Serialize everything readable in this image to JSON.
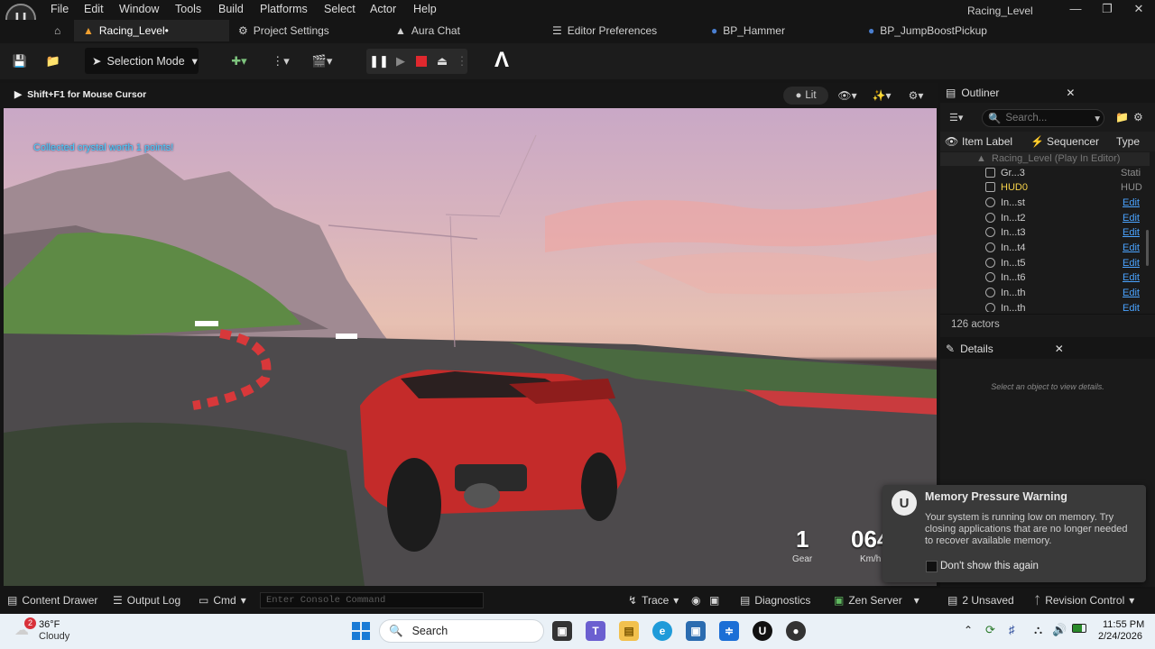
{
  "menu": [
    "File",
    "Edit",
    "Window",
    "Tools",
    "Build",
    "Platforms",
    "Select",
    "Actor",
    "Help"
  ],
  "window_title": "Racing_Level",
  "tabs": {
    "level": "Racing_Level•",
    "project_settings": "Project Settings",
    "aura_chat": "Aura Chat",
    "editor_preferences": "Editor Preferences",
    "bp_hammer": "BP_Hammer",
    "bp_jump": "BP_JumpBoostPickup"
  },
  "toolbar": {
    "selection_mode": "Selection Mode"
  },
  "viewport": {
    "hint": "Shift+F1 for Mouse Cursor",
    "lit": "Lit",
    "message": "Collected crystal worth 1 points!",
    "gear_value": "1",
    "gear_label": "Gear",
    "speed_value": "064",
    "speed_label": "Km/h"
  },
  "outliner": {
    "title": "Outliner",
    "search_placeholder": "Search...",
    "col_label": "Item Label",
    "col_sequencer": "Sequencer",
    "col_type": "Type",
    "root": "Racing_Level (Play In Editor)",
    "rows": [
      {
        "name": "Gr...3",
        "type": "Stati"
      },
      {
        "name": "HUD0",
        "type": "HUD"
      },
      {
        "name": "In...st",
        "type": "Edit"
      },
      {
        "name": "In...t2",
        "type": "Edit"
      },
      {
        "name": "In...t3",
        "type": "Edit"
      },
      {
        "name": "In...t4",
        "type": "Edit"
      },
      {
        "name": "In...t5",
        "type": "Edit"
      },
      {
        "name": "In...t6",
        "type": "Edit"
      },
      {
        "name": "In...th",
        "type": "Edit"
      },
      {
        "name": "In...th",
        "type": "Edit"
      }
    ],
    "count": "126 actors"
  },
  "details": {
    "title": "Details",
    "empty": "Select an object to view details."
  },
  "toast": {
    "title": "Memory Pressure Warning",
    "body": "Your system is running low on memory. Try closing applications that are no longer needed to recover available memory.",
    "checkbox": "Don't show this again"
  },
  "statusbar": {
    "content_drawer": "Content Drawer",
    "output_log": "Output Log",
    "cmd": "Cmd",
    "console_placeholder": "Enter Console Command",
    "trace": "Trace",
    "diagnostics": "Diagnostics",
    "zen_server": "Zen Server",
    "unsaved": "2 Unsaved",
    "revision_control": "Revision Control"
  },
  "taskbar": {
    "weather_temp": "36°F",
    "weather_desc": "Cloudy",
    "weather_badge": "2",
    "search": "Search",
    "time": "11:55 PM",
    "date": "2/24/2026"
  },
  "colors": {
    "accent_blue": "#4aa3ff",
    "hud_text": "#46d1ff",
    "tab_orange": "#f0a030"
  }
}
